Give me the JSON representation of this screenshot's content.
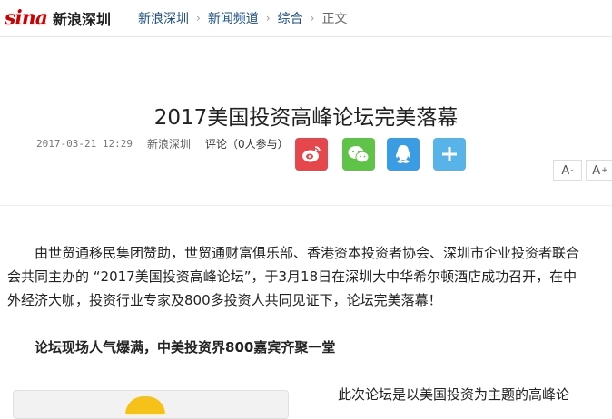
{
  "header": {
    "logo": {
      "sina": "sina",
      "sub": "新浪深圳"
    },
    "breadcrumb": [
      {
        "label": "新浪深圳"
      },
      {
        "label": "新闻频道"
      },
      {
        "label": "综合"
      },
      {
        "label": "正文"
      }
    ],
    "separator": "›"
  },
  "article": {
    "title": "2017美国投资高峰论坛完美落幕",
    "date": "2017-03-21 12:29",
    "source": "新浪深圳",
    "comment_label": "评论",
    "comment_count_text": "（0人参与）",
    "share_icons": [
      "weibo-icon",
      "wechat-icon",
      "qq-icon",
      "plus-icon"
    ],
    "font_buttons": {
      "decrease": "A",
      "decrease_mark": "-",
      "increase": "A",
      "increase_mark": "+"
    },
    "paragraph1": "由世贸通移民集团赞助，世贸通财富俱乐部、香港资本投资者协会、深圳市企业投资者联合会共同主办的 “2017美国投资高峰论坛”，于3月18日在深圳大中华希尔顿酒店成功召开，在中外经济大咖，投资行业专家及800多投资人共同见证下，论坛完美落幕！",
    "subheading": "论坛现场人气爆满，中美投资界800嘉宾齐聚一堂",
    "paragraph2": "此次论坛是以美国投资为主题的高峰论"
  },
  "colors": {
    "weibo": "#e5474d",
    "wechat": "#5fc348",
    "qq": "#3a9ce2",
    "more": "#57b3e8",
    "sina_red": "#cc0000",
    "link_blue": "#1a4e8a"
  }
}
